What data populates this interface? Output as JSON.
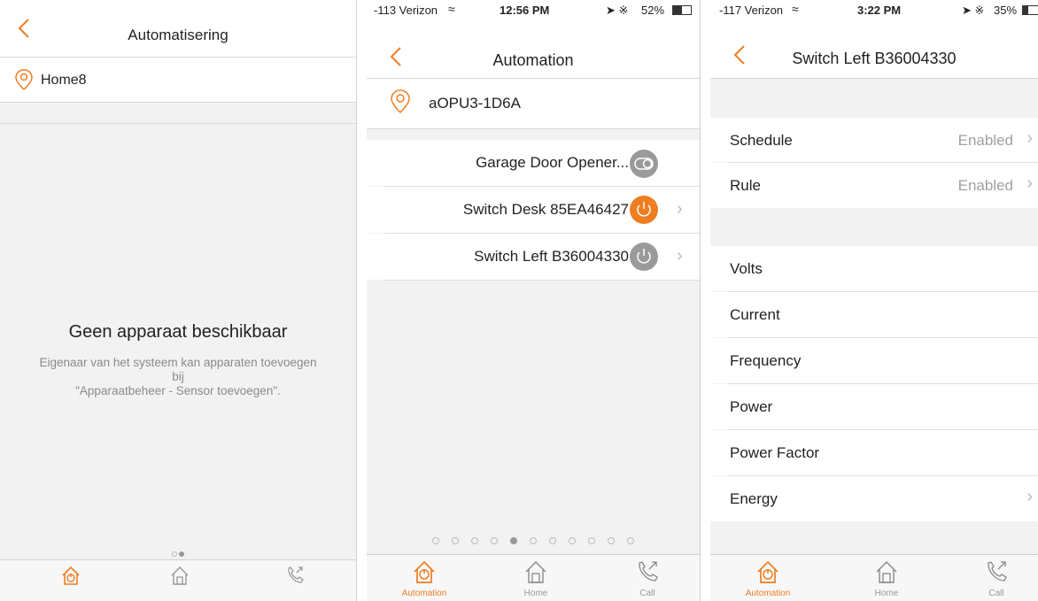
{
  "colors": {
    "accent": "#ef7d22",
    "gray": "#9a9a9a"
  },
  "screen1": {
    "title": "Automatisering",
    "location": "Home8",
    "empty_title": "Geen apparaat beschikbaar",
    "empty_line1": "Eigenaar van het systeem kan apparaten toevoegen",
    "empty_line2": "bij",
    "empty_line3": "\"Apparaatbeheer - Sensor toevoegen\".",
    "page_dots": {
      "count": 2,
      "active": 1
    }
  },
  "screen2": {
    "status": {
      "carrier": "-113 Verizon",
      "time": "12:56 PM",
      "battery": "52%"
    },
    "title": "Automation",
    "location": "aOPU3-1D6A",
    "devices": [
      {
        "name": "Garage Door Opener...",
        "icon": "toggle-switch-icon",
        "state": "gray"
      },
      {
        "name": "Switch Desk 85EA46427",
        "icon": "power-icon",
        "state": "orange"
      },
      {
        "name": "Switch Left B36004330",
        "icon": "power-icon",
        "state": "gray"
      }
    ],
    "page_dots": {
      "count": 11,
      "active": 4
    },
    "tabs": [
      "Automation",
      "Home",
      "Call"
    ]
  },
  "screen3": {
    "status": {
      "carrier": "-117 Verizon",
      "time": "3:22 PM",
      "battery": "35%"
    },
    "title": "Switch Left B36004330",
    "settings": [
      {
        "label": "Schedule",
        "value": "Enabled"
      },
      {
        "label": "Rule",
        "value": "Enabled"
      }
    ],
    "metrics": [
      "Volts",
      "Current",
      "Frequency",
      "Power",
      "Power Factor",
      "Energy"
    ],
    "tabs": [
      "Automation",
      "Home",
      "Call"
    ]
  }
}
